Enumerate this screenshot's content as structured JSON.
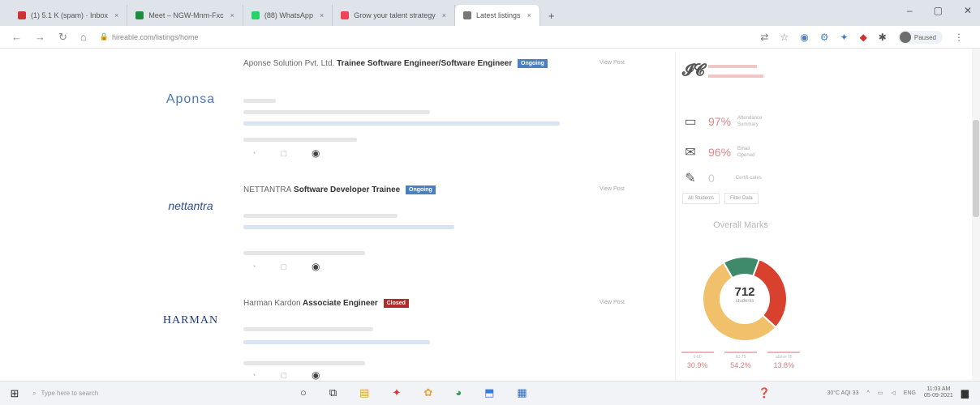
{
  "colors": {
    "accent_blue": "#4a7fc1",
    "badge_red": "#b52a2a",
    "donut_red": "#d9412f",
    "donut_yellow": "#f1c06a",
    "donut_green": "#3f8a6a"
  },
  "browser": {
    "tabs": [
      {
        "label": "(1) 5.1 K (spam) · Inbox",
        "fav_color": "#c33"
      },
      {
        "label": "Meet – NGW-Mnm-Fxc",
        "fav_color": "#1e8e3e"
      },
      {
        "label": "(88) WhatsApp",
        "fav_color": "#25d366"
      },
      {
        "label": "Grow your talent strategy",
        "fav_color": "#e45"
      },
      {
        "label": "Latest listings",
        "fav_color": "#777",
        "active": true
      }
    ],
    "new_tab": "+",
    "url": "hireable.com/listings/home",
    "profile_label": "Paused"
  },
  "listings": [
    {
      "company": "Aponse Solution Pvt. Ltd.",
      "role": "Trainee Software Engineer/Software Engineer",
      "badge": "Ongoing",
      "badge_color": "#4a7fc1",
      "logo_text": "Aponsa",
      "view_label": "View Post"
    },
    {
      "company": "NETTANTRA",
      "role": "Software Developer Trainee",
      "badge": "Ongoing",
      "badge_color": "#4a7fc1",
      "logo_text": "nettantra",
      "view_label": "View Post"
    },
    {
      "company": "Harman Kardon",
      "role": "Associate Engineer",
      "badge": "Closed",
      "badge_color": "#b52a2a",
      "logo_text": "HARMAN",
      "view_label": "View Post"
    }
  ],
  "panel": {
    "kpis": [
      {
        "icon": "monitor-icon",
        "value": "97%",
        "label": "Attendance Summary"
      },
      {
        "icon": "mail-icon",
        "value": "96%",
        "label": "Email Opened"
      },
      {
        "icon": "certificate-icon",
        "value": "0",
        "label": "Certifi-cates"
      }
    ],
    "buttons": [
      "All Students",
      "Filter Data"
    ],
    "overall_title": "Overall Marks",
    "donut_total": "712",
    "donut_sub": "students",
    "donut_segments": [
      {
        "label": "below 60",
        "value": 30.9,
        "color": "#d9412f"
      },
      {
        "label": "60-75",
        "value": 54.2,
        "color": "#f1c06a"
      },
      {
        "label": "above 75",
        "value": 13.8,
        "color": "#3f8a6a"
      }
    ],
    "breakdown": [
      {
        "label": "0-60",
        "value": "30.9%"
      },
      {
        "label": "60-75",
        "value": "54.2%"
      },
      {
        "label": "above 75",
        "value": "13.8%"
      }
    ]
  },
  "taskbar": {
    "search_placeholder": "Type here to search",
    "weather": "30°C AQI 33",
    "lang": "ENG",
    "time": "11:03 AM",
    "date": "05-09-2021"
  }
}
